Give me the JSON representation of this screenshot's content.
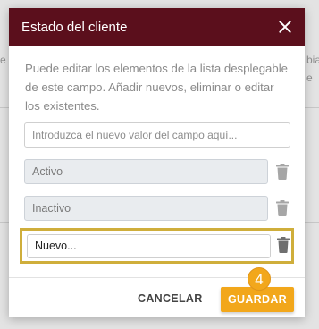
{
  "background": {
    "left_snippets": [
      "...",
      "e",
      "v"
    ],
    "right_snippets": [
      "bia",
      "e"
    ]
  },
  "dialog": {
    "title": "Estado del cliente",
    "close_icon": "close-icon",
    "description": "Puede editar los elementos de la lista desplegable de este campo. Añadir nuevos, eliminar o editar los existentes.",
    "new_value_placeholder": "Introduzca el nuevo valor del campo aquí...",
    "options": [
      {
        "value": "Activo",
        "icon": "trash-icon"
      },
      {
        "value": "Inactivo",
        "icon": "trash-icon"
      }
    ],
    "new_option": {
      "value": "Nuevo...",
      "icon": "trash-icon"
    },
    "step_badge": "4",
    "cancel_label": "CANCELAR",
    "save_label": "GUARDAR"
  },
  "colors": {
    "header": "#5b0f1c",
    "accent": "#f2a71b",
    "highlight": "#cfae3b"
  }
}
